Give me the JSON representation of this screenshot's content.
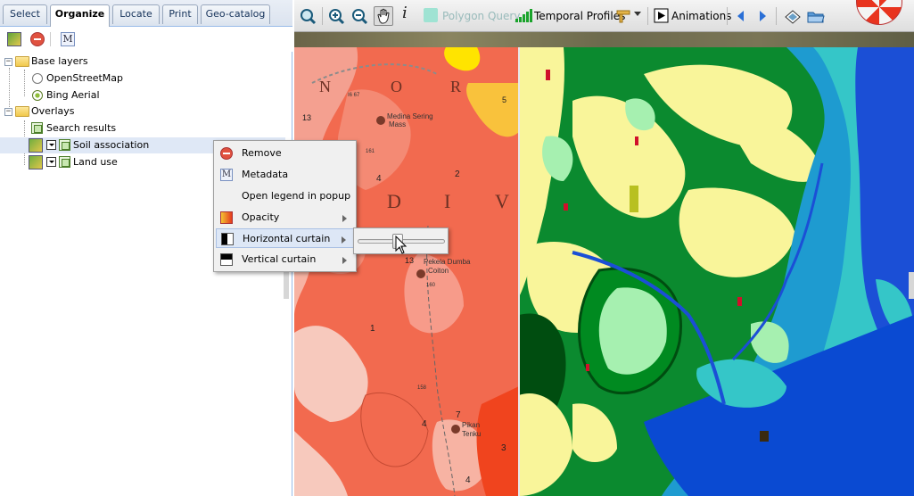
{
  "tabs": [
    {
      "label": "Select",
      "active": false
    },
    {
      "label": "Organize",
      "active": true
    },
    {
      "label": "Locate",
      "active": false
    },
    {
      "label": "Print",
      "active": false
    },
    {
      "label": "Geo-catalog",
      "active": false
    }
  ],
  "left_toolbar": {
    "icons": [
      "add-layer-icon",
      "remove-icon",
      "metadata-icon"
    ],
    "metadata_glyph": "M"
  },
  "tree": {
    "base_layers": {
      "label": "Base layers",
      "items": [
        {
          "label": "OpenStreetMap",
          "selected": false
        },
        {
          "label": "Bing Aerial",
          "selected": true
        }
      ]
    },
    "overlays": {
      "label": "Overlays",
      "items": [
        {
          "label": "Search results"
        },
        {
          "label": "Soil association"
        },
        {
          "label": "Land use"
        }
      ]
    }
  },
  "context_menu": {
    "items": [
      {
        "label": "Remove",
        "icon": "remove-icon"
      },
      {
        "label": "Metadata",
        "icon": "metadata-icon",
        "glyph": "M"
      },
      {
        "label": "Open legend in popup",
        "icon": ""
      },
      {
        "label": "Opacity",
        "icon": "opacity-icon",
        "submenu": true
      },
      {
        "label": "Horizontal curtain",
        "icon": "horizontal-curtain-icon",
        "submenu": true,
        "active": true
      },
      {
        "label": "Vertical curtain",
        "icon": "vertical-curtain-icon",
        "submenu": true
      }
    ],
    "curtain_slider_value": 0.45
  },
  "map_toolbar": {
    "polygon_query": "Polygon Query",
    "temporal_profiles": "Temporal Profiles",
    "animations": "Animations",
    "info_glyph": "i"
  },
  "geo_map_labels": {
    "n": "N",
    "o": "O",
    "r": "R",
    "d": "D",
    "i": "I",
    "v": "V",
    "medina": "Medina Sering",
    "mass": "Mass",
    "pekela": "Pekela Dumba",
    "coiton": "Coiton",
    "pikan": "Pikan",
    "tenku": "Tenku",
    "n13a": "13",
    "n13b": "13",
    "n5": "5",
    "n4a": "4",
    "n2": "2",
    "n1": "1",
    "n4b": "4",
    "n7": "7",
    "n4c": "4",
    "n3": "3",
    "n161": "161",
    "n160": "160",
    "n158": "158",
    "nI16": "I6 67"
  },
  "colors": {
    "accent": "#99bbe8",
    "geo_red": "#f26a4f",
    "geo_salmon": "#f4a090",
    "land_yellow": "#f9f59a",
    "land_green": "#0b8a2f",
    "water_blue": "#1b4fd6",
    "water_cyan": "#35c6c8"
  }
}
